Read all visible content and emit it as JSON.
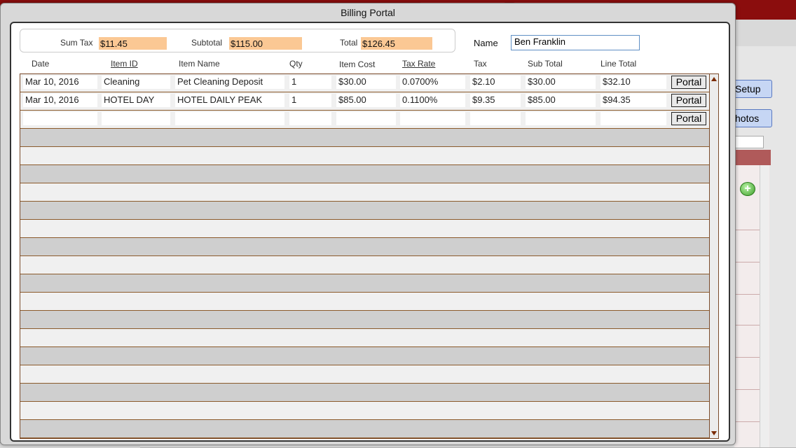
{
  "background": {
    "buttons": [
      {
        "label": "Setup"
      },
      {
        "label": "hotos"
      }
    ]
  },
  "dialog": {
    "title": "Billing Portal",
    "summary": {
      "sum_tax_label": "Sum Tax",
      "sum_tax_value": "$11.45",
      "subtotal_label": "Subtotal",
      "subtotal_value": "$115.00",
      "total_label": "Total",
      "total_value": "$126.45"
    },
    "name_label": "Name",
    "name_value": "Ben Franklin",
    "columns": {
      "date": "Date",
      "item_id": "Item ID",
      "item_name": "Item Name",
      "qty": "Qty",
      "item_cost": "Item Cost",
      "tax_rate": "Tax Rate",
      "tax": "Tax",
      "sub_total": "Sub Total",
      "line_total": "Line Total"
    },
    "rows": [
      {
        "date": "Mar 10, 2016",
        "item_id": "Cleaning",
        "item_name": "Pet Cleaning Deposit",
        "qty": "1",
        "item_cost": "$30.00",
        "tax_rate": "0.0700%",
        "tax": "$2.10",
        "sub_total": "$30.00",
        "line_total": "$32.10",
        "portal": "Portal"
      },
      {
        "date": "Mar 10, 2016",
        "item_id": "HOTEL DAY",
        "item_name": "HOTEL DAILY PEAK",
        "qty": "1",
        "item_cost": "$85.00",
        "tax_rate": "0.1100%",
        "tax": "$9.35",
        "sub_total": "$85.00",
        "line_total": "$94.35",
        "portal": "Portal"
      },
      {
        "date": "",
        "item_id": "",
        "item_name": "",
        "qty": "",
        "item_cost": "",
        "tax_rate": "",
        "tax": "",
        "sub_total": "",
        "line_total": "",
        "portal": "Portal"
      }
    ],
    "colors": {
      "summary_field": "#fbc894",
      "row_border": "#8b5a2b",
      "topbar": "#8b0d0d"
    }
  }
}
